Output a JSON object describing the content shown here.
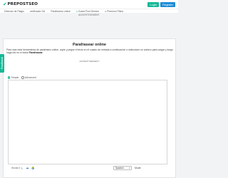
{
  "header": {
    "logo_text": "PREPOSTSEO",
    "login_label": "Login",
    "register_label": "Register"
  },
  "nav": {
    "items": [
      {
        "label": "Detector de Plagio"
      },
      {
        "label": "verificador DA"
      },
      {
        "label": "Parafrasear online"
      },
      {
        "label": "Guest Post Service"
      },
      {
        "label": "Premium Plans"
      }
    ]
  },
  "ads": {
    "top_label": "ADVERTISEMENT",
    "mid_label": "ADVERTISEMENT"
  },
  "feedback": {
    "label": "Feedback"
  },
  "tool": {
    "title": "Parafrasear online",
    "description_text": "Para usar esta herramienta de parafraseo online, copie y pegue el texto en el cuadro de entrada a continuación o seleccione un archivo para cargar y luego haga clic en el botón ",
    "description_bold": "Parafrasear",
    "description_end": ".",
    "modes": [
      {
        "label": "Simple",
        "selected": true
      },
      {
        "label": "Advanced",
        "selected": false
      }
    ],
    "word_count_label": "Words:0",
    "language_value": "Spanish",
    "mode_label": "Mode"
  },
  "icons": {
    "cloud": "cloud-upload-icon",
    "drive": "google-drive-icon",
    "pencil": "pencil-icon"
  },
  "colors": {
    "brand_green": "#17b897",
    "brand_blue": "#1e8cd6"
  }
}
